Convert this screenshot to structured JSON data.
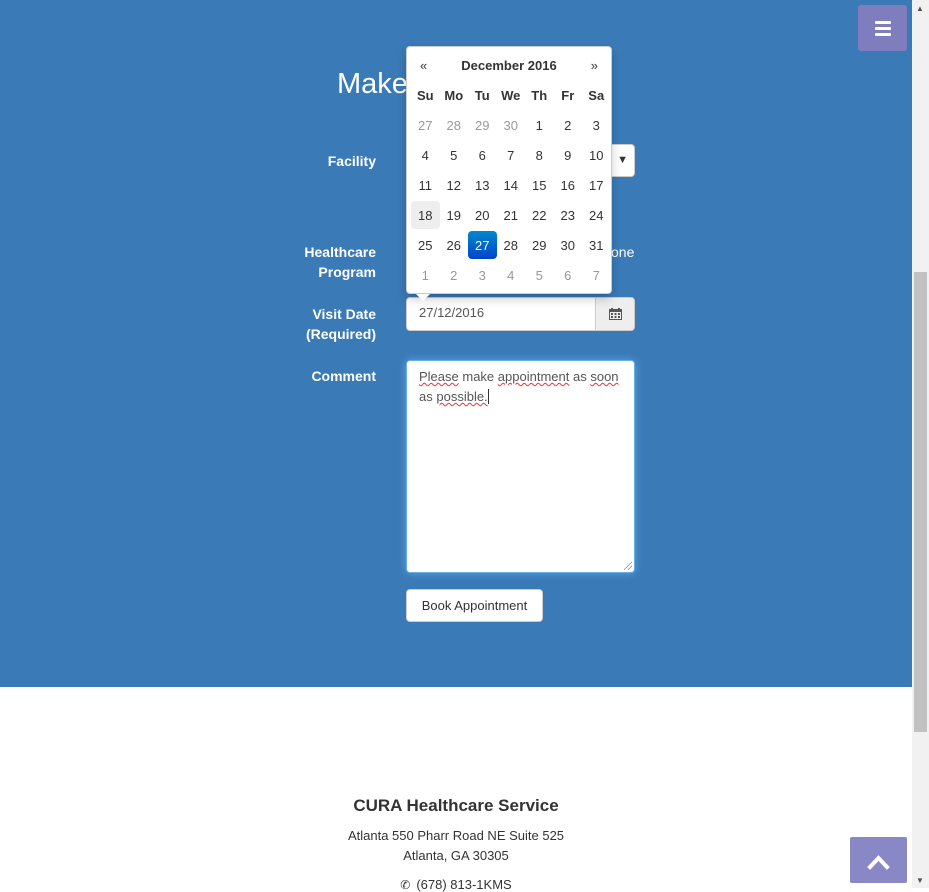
{
  "header": {
    "title_visible": "Make",
    "menu_icon": "hamburger-icon"
  },
  "form": {
    "facility_label": "Facility",
    "healthcare_label_1": "Healthcare",
    "healthcare_label_2": "Program",
    "radio_none_visible": "one",
    "visit_date_label_1": "Visit Date",
    "visit_date_label_2": "(Required)",
    "visit_date_value": "27/12/2016",
    "comment_label": "Comment",
    "comment_words": [
      "Please",
      "make",
      "appointment",
      "as",
      "soon",
      "as",
      "possible."
    ],
    "book_button": "Book Appointment"
  },
  "datepicker": {
    "prev": "«",
    "next": "»",
    "month_title": "December 2016",
    "weekdays": [
      "Su",
      "Mo",
      "Tu",
      "We",
      "Th",
      "Fr",
      "Sa"
    ],
    "weeks": [
      [
        "27",
        "28",
        "29",
        "30",
        "1",
        "2",
        "3"
      ],
      [
        "4",
        "5",
        "6",
        "7",
        "8",
        "9",
        "10"
      ],
      [
        "11",
        "12",
        "13",
        "14",
        "15",
        "16",
        "17"
      ],
      [
        "18",
        "19",
        "20",
        "21",
        "22",
        "23",
        "24"
      ],
      [
        "25",
        "26",
        "27",
        "28",
        "29",
        "30",
        "31"
      ],
      [
        "1",
        "2",
        "3",
        "4",
        "5",
        "6",
        "7"
      ]
    ],
    "today": "18",
    "selected": "27"
  },
  "footer": {
    "company": "CURA Healthcare Service",
    "address_1": "Atlanta 550 Pharr Road NE Suite 525",
    "address_2": "Atlanta, GA 30305",
    "phone": "(678) 813-1KMS"
  },
  "colors": {
    "hero_bg": "#3a7ab7",
    "menu_bg": "#7f7dbd",
    "selected_day": "#0a5fbf"
  }
}
